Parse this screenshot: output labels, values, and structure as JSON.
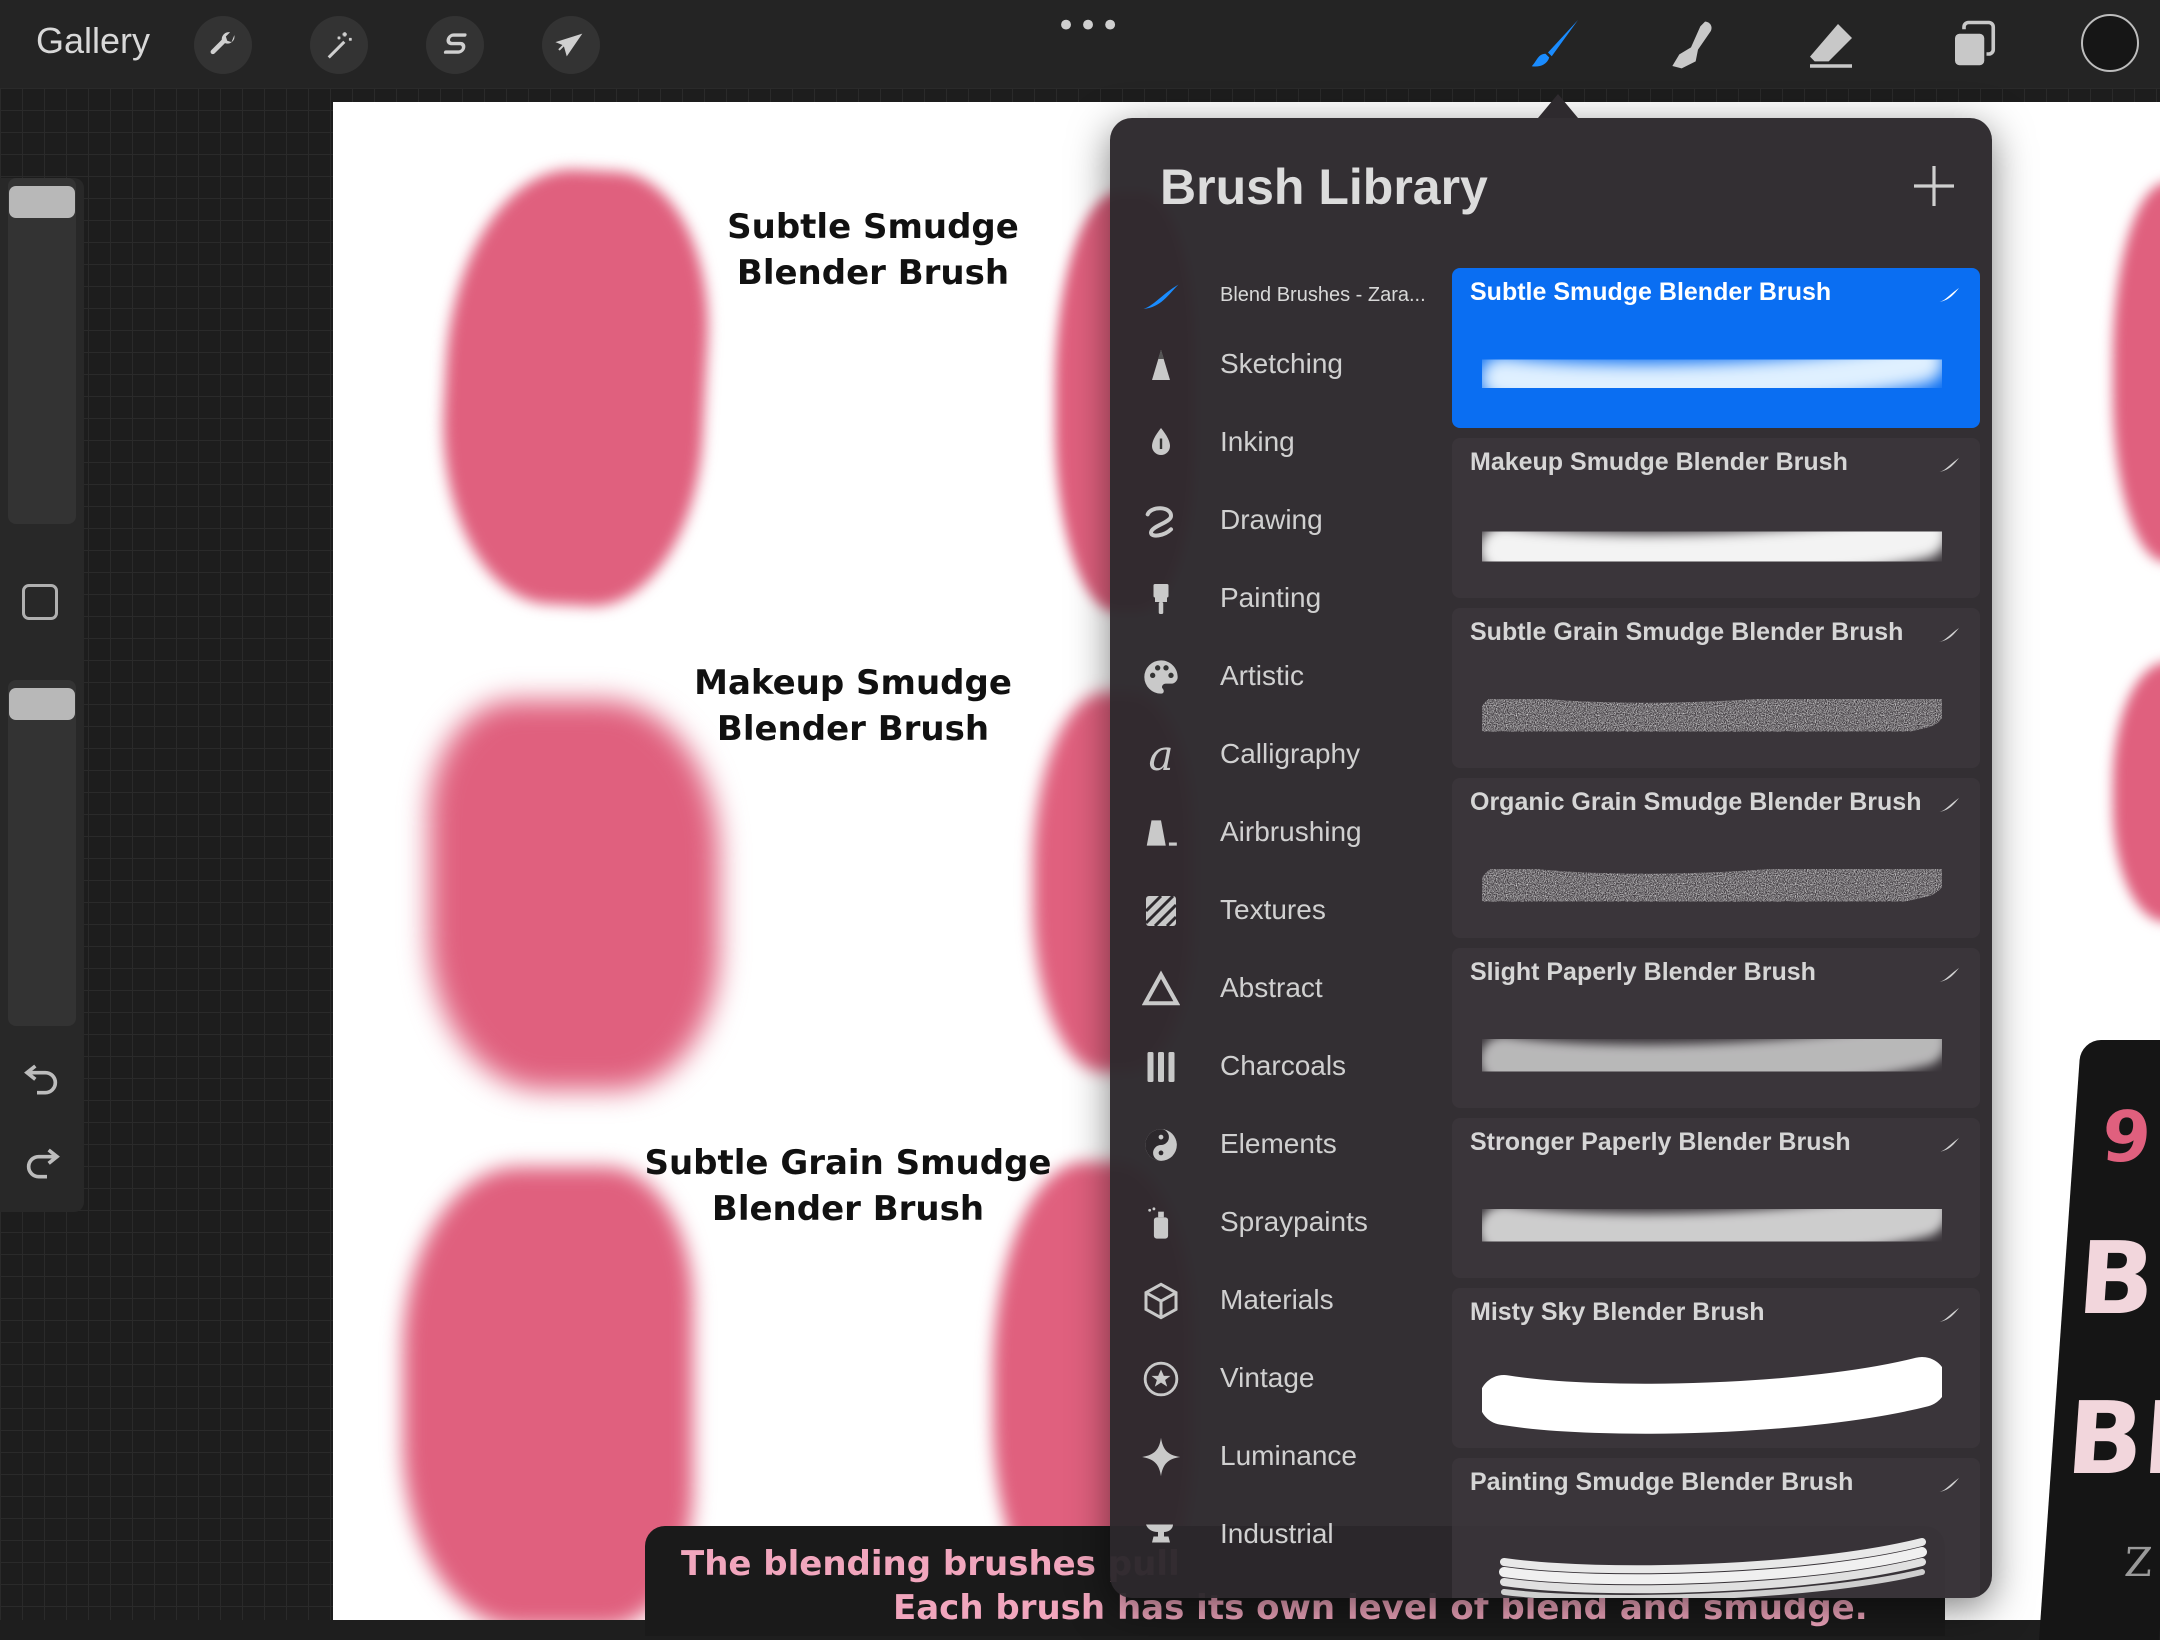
{
  "toolbar": {
    "gallery_label": "Gallery",
    "more_label": "•••",
    "left_tools": [
      {
        "name": "Actions",
        "icon": "wrench-icon"
      },
      {
        "name": "Adjustments",
        "icon": "magic-wand-icon"
      },
      {
        "name": "Selection",
        "icon": "selection-s-icon"
      },
      {
        "name": "Transform",
        "icon": "arrow-cursor-icon"
      }
    ],
    "right_tools": [
      {
        "name": "Paint",
        "icon": "brush-icon",
        "active": true,
        "color": "#1a8cff"
      },
      {
        "name": "Smudge",
        "icon": "smudge-finger-icon"
      },
      {
        "name": "Erase",
        "icon": "eraser-icon"
      },
      {
        "name": "Layers",
        "icon": "layers-icon"
      }
    ],
    "current_color": "#161616"
  },
  "sidebar": {
    "brush_size_level": 1.0,
    "opacity_level": 1.0,
    "modify_button_icon": "square-icon",
    "undo_icon": "undo-icon",
    "redo_icon": "redo-icon"
  },
  "artwork": {
    "labels": [
      {
        "line1": "Subtle Smudge",
        "line2": "Blender Brush"
      },
      {
        "line1": "Makeup Smudge",
        "line2": "Blender Brush"
      },
      {
        "line1": "Subtle Grain Smudge",
        "line2": "Blender Brush"
      }
    ],
    "blob_color": "#e0607e",
    "banner_line1": "The blending brushes pull",
    "banner_line2": "Each brush has its own level of blend and smudge.",
    "promo_number": "9",
    "promo_line1": "BL",
    "promo_line2": "BR",
    "promo_small": "Z"
  },
  "library": {
    "title": "Brush Library",
    "add_icon": "plus-icon",
    "categories": [
      {
        "label": "Blend Brushes - Zara...",
        "icon": "imported-brush-icon",
        "active": true
      },
      {
        "label": "Sketching",
        "icon": "pencil-tip-icon"
      },
      {
        "label": "Inking",
        "icon": "pen-nib-icon"
      },
      {
        "label": "Drawing",
        "icon": "squiggle-icon"
      },
      {
        "label": "Painting",
        "icon": "paintbrush-icon"
      },
      {
        "label": "Artistic",
        "icon": "palette-icon"
      },
      {
        "label": "Calligraphy",
        "icon": "calligraphy-a-icon"
      },
      {
        "label": "Airbrushing",
        "icon": "airbrush-icon"
      },
      {
        "label": "Textures",
        "icon": "hatch-texture-icon"
      },
      {
        "label": "Abstract",
        "icon": "triangle-icon"
      },
      {
        "label": "Charcoals",
        "icon": "charcoal-sticks-icon"
      },
      {
        "label": "Elements",
        "icon": "yin-yang-icon"
      },
      {
        "label": "Spraypaints",
        "icon": "spray-can-icon"
      },
      {
        "label": "Materials",
        "icon": "cube-icon"
      },
      {
        "label": "Vintage",
        "icon": "star-badge-icon"
      },
      {
        "label": "Luminance",
        "icon": "sparkle-icon"
      },
      {
        "label": "Industrial",
        "icon": "anvil-icon"
      }
    ],
    "brushes": [
      {
        "name": "Subtle Smudge Blender Brush",
        "style": "soft",
        "selected": true
      },
      {
        "name": "Makeup Smudge Blender Brush",
        "style": "soft"
      },
      {
        "name": "Subtle Grain Smudge Blender Brush",
        "style": "grain"
      },
      {
        "name": "Organic Grain Smudge Blender Brush",
        "style": "grain"
      },
      {
        "name": "Slight Paperly Blender Brush",
        "style": "paper"
      },
      {
        "name": "Stronger Paperly Blender Brush",
        "style": "paper"
      },
      {
        "name": "Misty Sky Blender Brush",
        "style": "solid"
      },
      {
        "name": "Painting Smudge Blender Brush",
        "style": "streaky"
      }
    ],
    "selected_color": "#0a6ef2"
  }
}
